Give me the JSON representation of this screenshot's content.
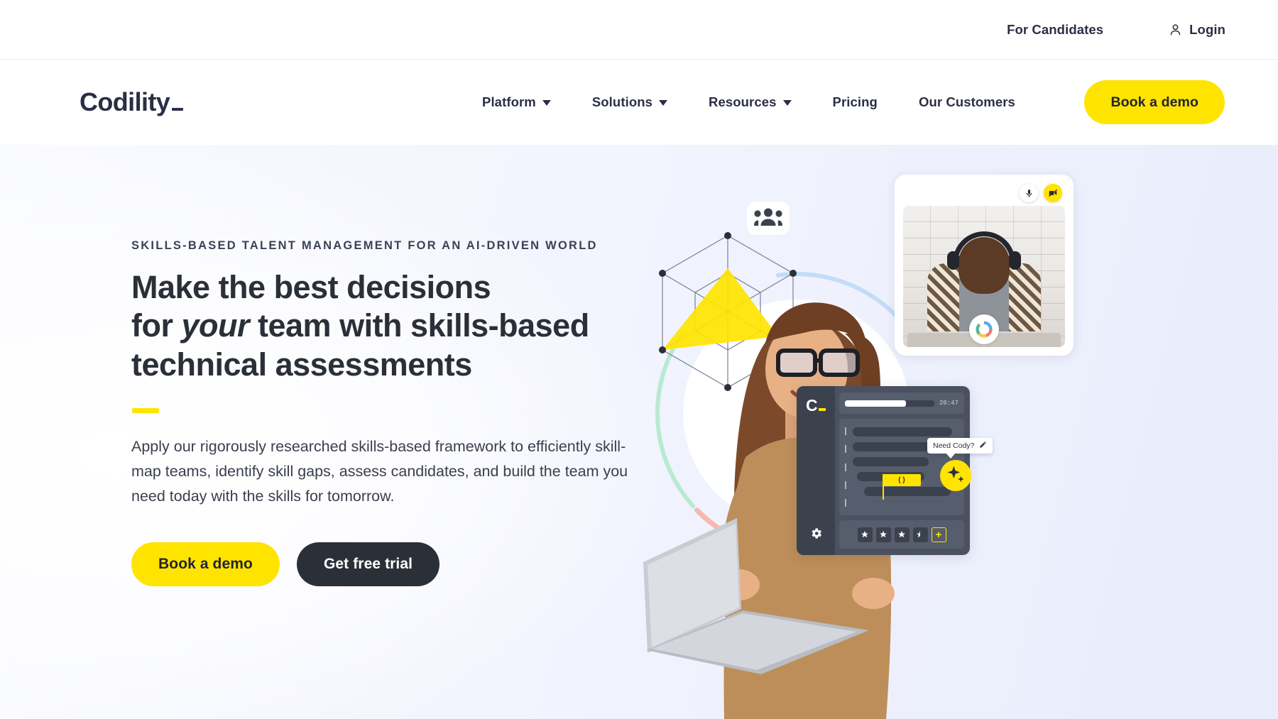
{
  "utility": {
    "for_candidates": "For Candidates",
    "login": "Login",
    "login_icon": "user-icon"
  },
  "nav": {
    "logo": "Codility",
    "items": [
      {
        "label": "Platform",
        "has_dropdown": true,
        "icon": "chevron-down-icon"
      },
      {
        "label": "Solutions",
        "has_dropdown": true,
        "icon": "chevron-down-icon"
      },
      {
        "label": "Resources",
        "has_dropdown": true,
        "icon": "chevron-down-icon"
      },
      {
        "label": "Pricing",
        "has_dropdown": false,
        "icon": ""
      },
      {
        "label": "Our Customers",
        "has_dropdown": false,
        "icon": ""
      }
    ],
    "cta": "Book a demo"
  },
  "hero": {
    "eyebrow": "SKILLS-BASED TALENT MANAGEMENT FOR AN AI-DRIVEN WORLD",
    "headline_line1": "Make the best decisions",
    "headline_line2_pre": "for ",
    "headline_line2_em": "your",
    "headline_line2_post": " team with skills-based",
    "headline_line3": "technical assessments",
    "lede": "Apply our rigorously researched skills-based framework to efficiently skill-map teams, identify skill gaps, assess candidates, and build the team you need today with the skills for tomorrow.",
    "primary_cta": "Book a demo",
    "secondary_cta": "Get free trial"
  },
  "art": {
    "people_badge_icon": "people-group-icon",
    "radar_icon": "hexagon-radar-chart",
    "video_card": {
      "mic_icon": "microphone-icon",
      "camera_icon": "camera-off-icon",
      "call_badge_icon": "codility-ring-icon"
    },
    "code_panel": {
      "logo": "C",
      "timer": "20:47",
      "progress_percent": 68,
      "code_token": "( )",
      "settings_icon": "gear-icon",
      "stars_full": 3,
      "stars_half": 1,
      "add_icon": "plus-icon",
      "tooltip": "Need Cody?",
      "tooltip_icon": "pencil-icon",
      "assistant_icon": "sparkle-icon"
    }
  },
  "colors": {
    "brand_yellow": "#ffe400",
    "dark": "#2b3038",
    "text": "#3a3f4d",
    "hero_bg": "#e8ecfb"
  }
}
